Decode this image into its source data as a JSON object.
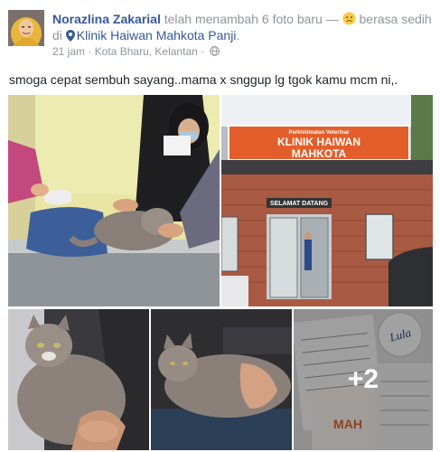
{
  "author": {
    "name": "Norazlina Zakarial",
    "action": " telah menambah 6 foto baru — ",
    "feeling": " berasa sedih di ",
    "place": "Klinik Haiwan Mahkota Panji",
    "trail": "."
  },
  "meta": {
    "time": "21 jam",
    "separator": " · ",
    "location": "Kota Bharu, Kelantan",
    "after_location": " · "
  },
  "message": "smoga cepat sembuh sayang..mama x snggup lg tgok kamu mcm ni,.",
  "photos": {
    "clinic_sign_line1": "Perkhidmatan Veterinar",
    "clinic_sign_line2": "KLINIK HAIWAN",
    "clinic_sign_line3": "MAHKOTA",
    "door_sign": "SELAMAT DATANG",
    "more_count": "+2",
    "paper_label": "Lula",
    "paper_brand": "MAH"
  },
  "icons": {
    "feeling": "sad-face-icon",
    "place": "location-pin-icon",
    "privacy": "globe-icon"
  },
  "colors": {
    "link": "#365899",
    "muted": "#90949c",
    "text": "#1d2129",
    "sign": "#e85f2b"
  }
}
